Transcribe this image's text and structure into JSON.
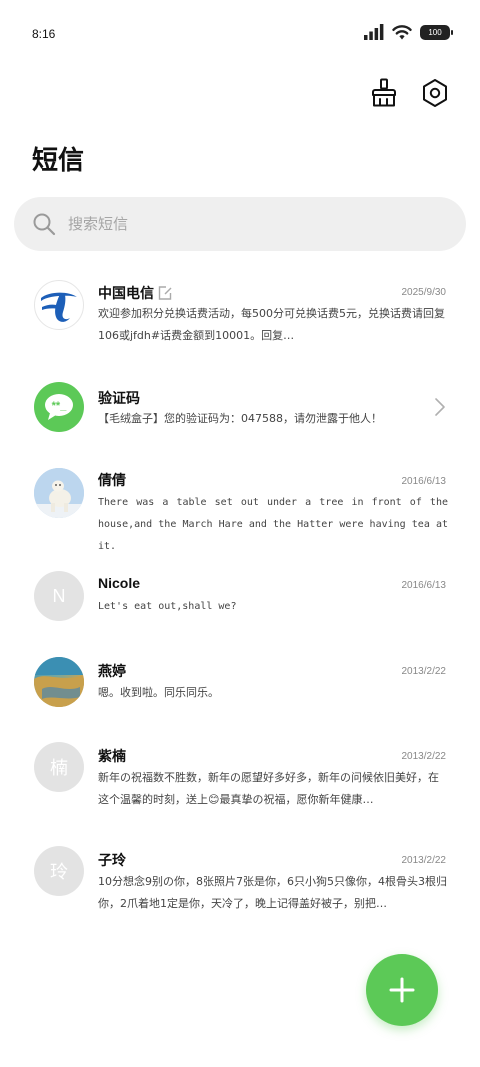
{
  "status_bar": {
    "time": "8:16",
    "battery": "100"
  },
  "header": {
    "title": "短信"
  },
  "search": {
    "placeholder": "搜索短信"
  },
  "messages": [
    {
      "sender": "中国电信",
      "date": "2025/9/30",
      "preview": "欢迎参加积分兑换话费活动，每500分可兑换话费5元，兑换话费请回复106或jfdh#话费金额到10001。回复…",
      "avatar_icon": "china-telecom-logo",
      "edit_badge": true
    },
    {
      "sender": "验证码",
      "date": "",
      "preview": "【毛绒盒子】您的验证码为：047588，请勿泄露于他人！",
      "avatar_icon": "verification-code-icon",
      "chevron": true
    },
    {
      "sender": "倩倩",
      "date": "2016/6/13",
      "preview": "There was a table set out under a tree in front of the house,and the March Hare and the Hatter were having tea at it.",
      "avatar_icon": "polar-bear-photo"
    },
    {
      "sender": "Nicole",
      "date": "2016/6/13",
      "preview": "Let's eat out,shall we?",
      "avatar_letter": "N"
    },
    {
      "sender": "燕婷",
      "date": "2013/2/22",
      "preview": "嗯。收到啦。同乐同乐。",
      "avatar_icon": "landscape-photo"
    },
    {
      "sender": "紫楠",
      "date": "2013/2/22",
      "preview": "新年の祝福数不胜数，新年の愿望好多好多，新年の问候依旧美好，在这个温馨的时刻，送上😊最真挚の祝福，愿你新年健康…",
      "avatar_letter": "楠"
    },
    {
      "sender": "子玲",
      "date": "2013/2/22",
      "preview": "10分想念9别の你，8张照片7张是你，6只小狗5只像你，4根骨头3根归你，2爪着地1定是你，天冷了，晚上记得盖好被子，别把…",
      "avatar_letter": "玲"
    }
  ],
  "colors": {
    "accent": "#5cc957",
    "telecom_blue": "#1d5fb8",
    "background": "#ffffff",
    "search_bg": "#efefef"
  }
}
